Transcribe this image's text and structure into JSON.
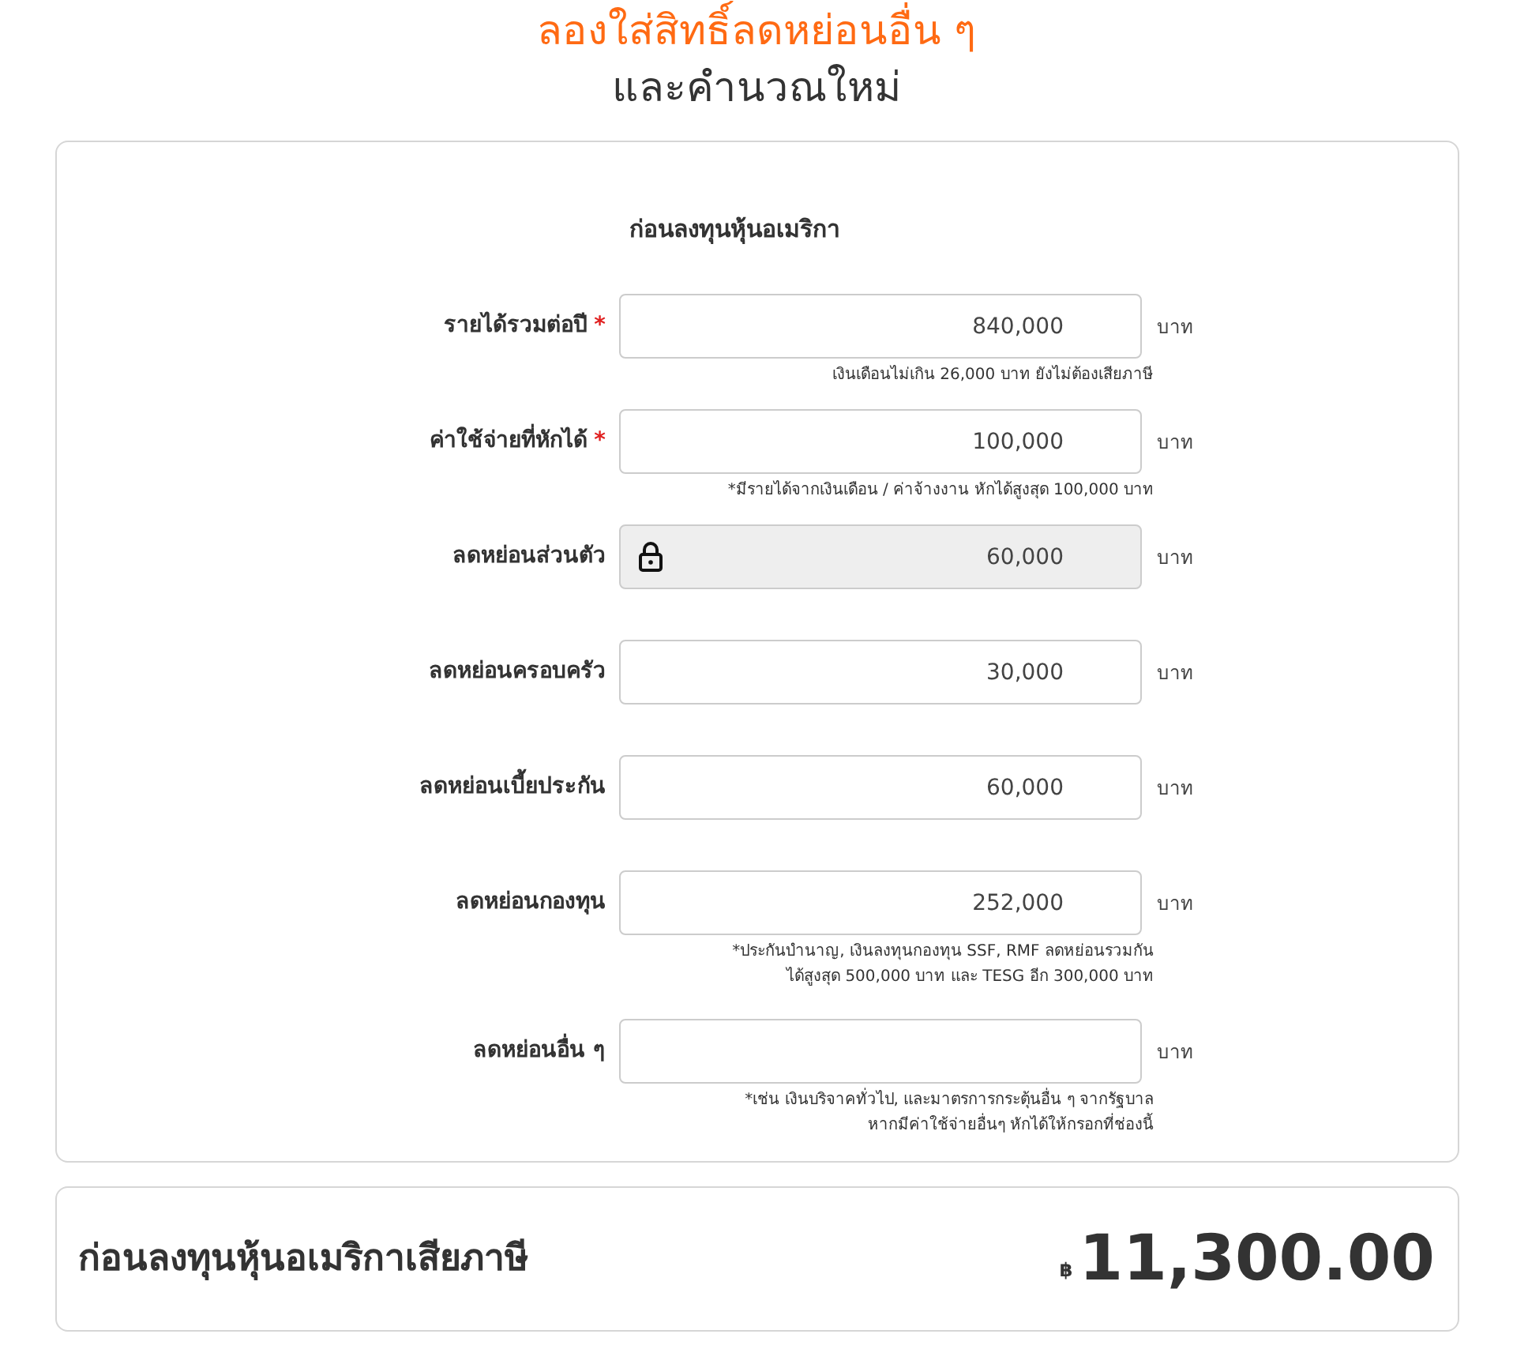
{
  "heading": {
    "line_1": "ลองใส่สิทธิ์ลดหย่อนอื่น ๆ",
    "line_2": "และคำนวณใหม่"
  },
  "form": {
    "title": "ก่อนลงทุนหุ้นอเมริกา",
    "fields": [
      {
        "kind": "input",
        "label": "รายได้รวมต่อปี",
        "required_mark": "*",
        "value": "840,000",
        "unit": "บาท",
        "notes": [
          "เงินเดือนไม่เกิน 26,000 บาท ยังไม่ต้องเสียภาษี"
        ]
      },
      {
        "kind": "input",
        "label": "ค่าใช้จ่ายที่หักได้",
        "required_mark": "*",
        "value": "100,000",
        "unit": "บาท",
        "notes": [
          "*มีรายได้จากเงินเดือน / ค่าจ้างงาน หักได้สูงสุด 100,000 บาท"
        ]
      },
      {
        "kind": "locked",
        "label": "ลดหย่อนส่วนตัว",
        "value": "60,000",
        "unit": "บาท"
      },
      {
        "kind": "input",
        "label": "ลดหย่อนครอบครัว",
        "value": "30,000",
        "unit": "บาท"
      },
      {
        "kind": "input",
        "label": "ลดหย่อนเบี้ยประกัน",
        "value": "60,000",
        "unit": "บาท"
      },
      {
        "kind": "input",
        "label": "ลดหย่อนกองทุน",
        "value": "252,000",
        "unit": "บาท",
        "notes": [
          "*ประกันบำนาญ, เงินลงทุนกองทุน SSF, RMF ลดหย่อนรวมกัน",
          "ได้สูงสุด 500,000 บาท และ TESG อีก 300,000 บาท"
        ]
      },
      {
        "kind": "input",
        "label": "ลดหย่อนอื่น ๆ",
        "unit": "บาท",
        "notes": [
          "*เช่น เงินบริจาคทั่วไป, และมาตรการกระตุ้นอื่น ๆ จากรัฐบาล",
          "หากมีค่าใช้จ่ายอื่นๆ หักได้ให้กรอกที่ช่องนี้"
        ]
      }
    ]
  },
  "result": {
    "label": "ก่อนลงทุนหุ้นอเมริกาเสียภาษี",
    "currency": "฿",
    "amount": "11,300.00"
  }
}
